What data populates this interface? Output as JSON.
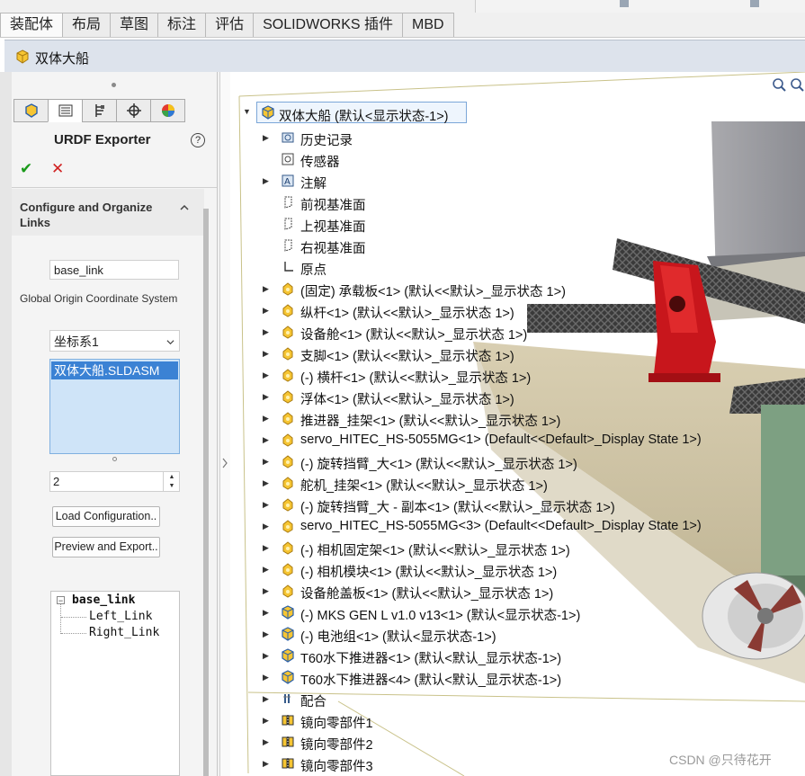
{
  "ribbon": {
    "tabs": [
      "装配体",
      "布局",
      "草图",
      "标注",
      "评估",
      "SOLIDWORKS 插件",
      "MBD"
    ]
  },
  "document": {
    "title": "双体大船"
  },
  "property_manager": {
    "title": "URDF Exporter",
    "help": "?",
    "ok": "✔",
    "cancel": "✕",
    "group_title": "Configure and Organize Links",
    "link_name_value": "base_link",
    "global_origin_label": "Global Origin Coordinate System",
    "coordinate_system_value": "坐标系1",
    "assembly_item": "双体大船.SLDASM",
    "number_value": "2",
    "load_button": "Load Configuration..",
    "preview_button": "Preview and Export..",
    "link_tree": {
      "root": "base_link",
      "children": [
        "Left_Link",
        "Right_Link"
      ]
    }
  },
  "feature_tree": {
    "root": "双体大船 (默认<显示状态-1>)",
    "items": [
      {
        "label": "历史记录",
        "icon": "history-icon",
        "expand": true
      },
      {
        "label": "传感器",
        "icon": "sensor-icon",
        "expand": false
      },
      {
        "label": "注解",
        "icon": "annotation-icon",
        "expand": true
      },
      {
        "label": "前视基准面",
        "icon": "plane-icon",
        "expand": false
      },
      {
        "label": "上视基准面",
        "icon": "plane-icon",
        "expand": false
      },
      {
        "label": "右视基准面",
        "icon": "plane-icon",
        "expand": false
      },
      {
        "label": "原点",
        "icon": "origin-icon",
        "expand": false
      },
      {
        "label": "(固定) 承载板<1> (默认<<默认>_显示状态 1>)",
        "icon": "part-icon",
        "expand": true
      },
      {
        "label": "纵杆<1> (默认<<默认>_显示状态 1>)",
        "icon": "part-icon",
        "expand": true
      },
      {
        "label": "设备舱<1> (默认<<默认>_显示状态 1>)",
        "icon": "part-icon",
        "expand": true
      },
      {
        "label": "支脚<1> (默认<<默认>_显示状态 1>)",
        "icon": "part-icon",
        "expand": true
      },
      {
        "label": "(-) 横杆<1> (默认<<默认>_显示状态 1>)",
        "icon": "part-icon",
        "expand": true
      },
      {
        "label": "浮体<1> (默认<<默认>_显示状态 1>)",
        "icon": "part-icon",
        "expand": true
      },
      {
        "label": "推进器_挂架<1> (默认<<默认>_显示状态 1>)",
        "icon": "part-icon",
        "expand": true
      },
      {
        "label": "servo_HITEC_HS-5055MG<1> (Default<<Default>_Display State 1>)",
        "icon": "part-icon",
        "expand": true
      },
      {
        "label": "(-) 旋转挡臂_大<1> (默认<<默认>_显示状态 1>)",
        "icon": "part-icon",
        "expand": true
      },
      {
        "label": "舵机_挂架<1> (默认<<默认>_显示状态 1>)",
        "icon": "part-icon",
        "expand": true
      },
      {
        "label": "(-) 旋转挡臂_大 - 副本<1> (默认<<默认>_显示状态 1>)",
        "icon": "part-icon",
        "expand": true
      },
      {
        "label": "servo_HITEC_HS-5055MG<3> (Default<<Default>_Display State 1>)",
        "icon": "part-icon",
        "expand": true
      },
      {
        "label": "(-) 相机固定架<1> (默认<<默认>_显示状态 1>)",
        "icon": "part-icon",
        "expand": true
      },
      {
        "label": "(-) 相机模块<1> (默认<<默认>_显示状态 1>)",
        "icon": "part-icon",
        "expand": true
      },
      {
        "label": "设备舱盖板<1> (默认<<默认>_显示状态 1>)",
        "icon": "part-icon",
        "expand": true
      },
      {
        "label": "(-) MKS GEN L v1.0 v13<1> (默认<显示状态-1>)",
        "icon": "assembly-icon",
        "expand": true
      },
      {
        "label": "(-) 电池组<1> (默认<显示状态-1>)",
        "icon": "assembly-icon",
        "expand": true
      },
      {
        "label": "T60水下推进器<1> (默认<默认_显示状态-1>)",
        "icon": "assembly-icon",
        "expand": true
      },
      {
        "label": "T60水下推进器<4> (默认<默认_显示状态-1>)",
        "icon": "assembly-icon",
        "expand": true
      },
      {
        "label": "配合",
        "icon": "mates-icon",
        "expand": true
      },
      {
        "label": "镜向零部件1",
        "icon": "mirror-icon",
        "expand": true
      },
      {
        "label": "镜向零部件2",
        "icon": "mirror-icon",
        "expand": true
      },
      {
        "label": "镜向零部件3",
        "icon": "mirror-icon",
        "expand": true
      }
    ]
  },
  "watermark": "CSDN @只待花开"
}
